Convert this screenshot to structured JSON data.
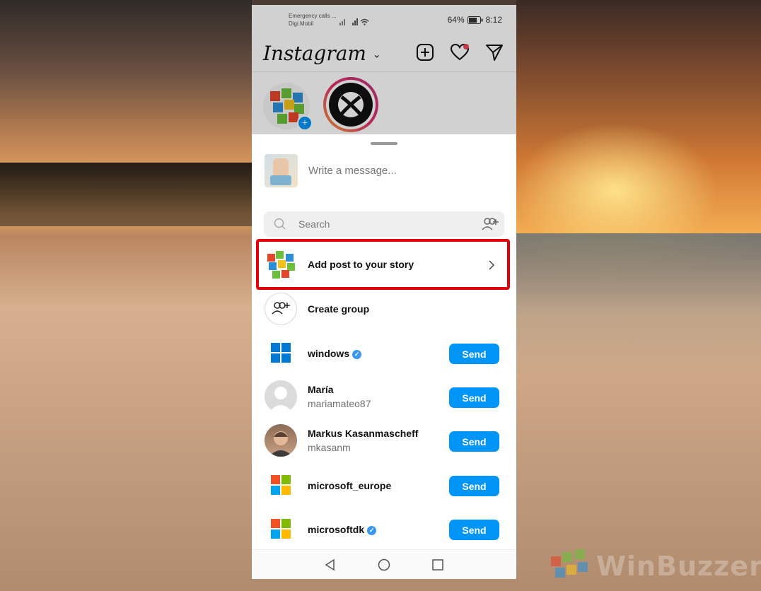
{
  "status_bar": {
    "line1": "Emergency calls ...",
    "line2": "Digi.Mobil",
    "battery": "64%",
    "time": "8:12"
  },
  "header": {
    "logo": "Instagram",
    "icons": [
      "add-post-icon",
      "heart-icon",
      "direct-message-icon"
    ]
  },
  "share_sheet": {
    "message_placeholder": "Write a message...",
    "search_placeholder": "Search",
    "add_story_label": "Add post to your story",
    "create_group_label": "Create group",
    "recipients": [
      {
        "name": "windows",
        "verified": true,
        "username": "",
        "button": "Send"
      },
      {
        "name": "María",
        "verified": false,
        "username": "mariamateo87",
        "button": "Send"
      },
      {
        "name": "Markus Kasanmascheff",
        "verified": false,
        "username": "mkasanm",
        "button": "Send"
      },
      {
        "name": "microsoft_europe",
        "verified": false,
        "username": "",
        "button": "Send"
      },
      {
        "name": "microsoftdk",
        "verified": true,
        "username": "",
        "button": "Send"
      }
    ]
  },
  "watermark": "WinBuzzer",
  "colors": {
    "send_button": "#0095f6",
    "highlight_border": "#e3000b",
    "verified_badge": "#3897f0"
  }
}
